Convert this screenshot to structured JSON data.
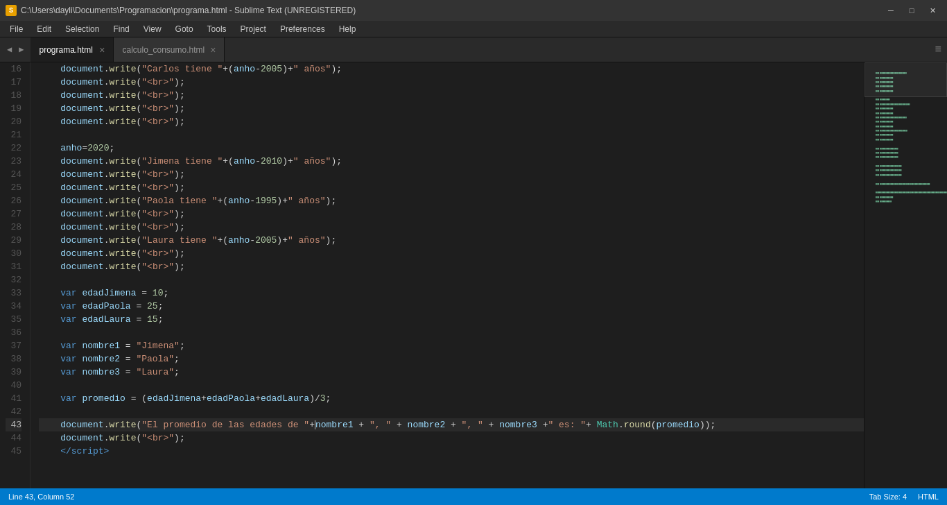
{
  "titlebar": {
    "icon": "ST",
    "title": "C:\\Users\\dayli\\Documents\\Programacion\\programa.html - Sublime Text (UNREGISTERED)",
    "minimize": "─",
    "maximize": "□",
    "close": "✕"
  },
  "menubar": {
    "items": [
      "File",
      "Edit",
      "Selection",
      "Find",
      "View",
      "Goto",
      "Tools",
      "Project",
      "Preferences",
      "Help"
    ]
  },
  "tabs": {
    "left_arrow": "◀",
    "right_arrow": "▶",
    "active_tab": "programa.html",
    "inactive_tab": "calculo_consumo.html",
    "close": "×",
    "scroll_right": "≡"
  },
  "statusbar": {
    "line_col": "Line 43, Column 52",
    "tab_size": "Tab Size: 4",
    "syntax": "HTML"
  },
  "lines": [
    {
      "num": "16",
      "content": "doc_write_carlos"
    },
    {
      "num": "17",
      "content": "doc_write_br"
    },
    {
      "num": "18",
      "content": "doc_write_br"
    },
    {
      "num": "19",
      "content": "doc_write_br"
    },
    {
      "num": "20",
      "content": "doc_write_br"
    },
    {
      "num": "21",
      "content": "empty"
    },
    {
      "num": "22",
      "content": "anho_2020"
    },
    {
      "num": "23",
      "content": "doc_write_jimena"
    },
    {
      "num": "24",
      "content": "doc_write_br"
    },
    {
      "num": "25",
      "content": "doc_write_br"
    },
    {
      "num": "26",
      "content": "doc_write_paola"
    },
    {
      "num": "27",
      "content": "doc_write_br"
    },
    {
      "num": "28",
      "content": "doc_write_br"
    },
    {
      "num": "29",
      "content": "doc_write_laura"
    },
    {
      "num": "30",
      "content": "doc_write_br"
    },
    {
      "num": "31",
      "content": "doc_write_br"
    },
    {
      "num": "32",
      "content": "empty"
    },
    {
      "num": "33",
      "content": "var_edadJimena"
    },
    {
      "num": "34",
      "content": "var_edadPaola"
    },
    {
      "num": "35",
      "content": "var_edadLaura"
    },
    {
      "num": "36",
      "content": "empty"
    },
    {
      "num": "37",
      "content": "var_nombre1"
    },
    {
      "num": "38",
      "content": "var_nombre2"
    },
    {
      "num": "39",
      "content": "var_nombre3"
    },
    {
      "num": "40",
      "content": "empty"
    },
    {
      "num": "41",
      "content": "var_promedio"
    },
    {
      "num": "42",
      "content": "empty"
    },
    {
      "num": "43",
      "content": "doc_write_promedio",
      "highlighted": true
    },
    {
      "num": "44",
      "content": "doc_write_br2"
    },
    {
      "num": "45",
      "content": "script_close"
    }
  ]
}
